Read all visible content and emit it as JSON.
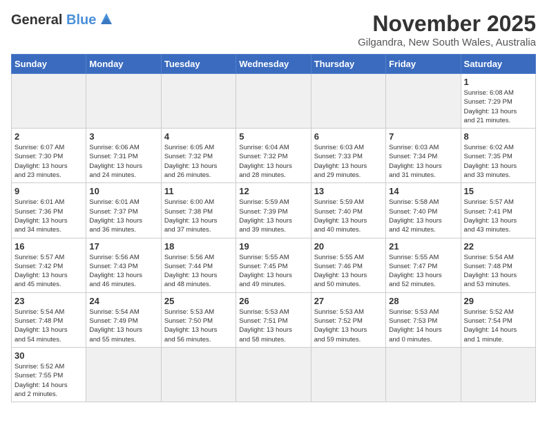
{
  "header": {
    "logo_general": "General",
    "logo_blue": "Blue",
    "month_title": "November 2025",
    "location": "Gilgandra, New South Wales, Australia"
  },
  "weekdays": [
    "Sunday",
    "Monday",
    "Tuesday",
    "Wednesday",
    "Thursday",
    "Friday",
    "Saturday"
  ],
  "weeks": [
    [
      {
        "day": "",
        "info": ""
      },
      {
        "day": "",
        "info": ""
      },
      {
        "day": "",
        "info": ""
      },
      {
        "day": "",
        "info": ""
      },
      {
        "day": "",
        "info": ""
      },
      {
        "day": "",
        "info": ""
      },
      {
        "day": "1",
        "info": "Sunrise: 6:08 AM\nSunset: 7:29 PM\nDaylight: 13 hours\nand 21 minutes."
      }
    ],
    [
      {
        "day": "2",
        "info": "Sunrise: 6:07 AM\nSunset: 7:30 PM\nDaylight: 13 hours\nand 23 minutes."
      },
      {
        "day": "3",
        "info": "Sunrise: 6:06 AM\nSunset: 7:31 PM\nDaylight: 13 hours\nand 24 minutes."
      },
      {
        "day": "4",
        "info": "Sunrise: 6:05 AM\nSunset: 7:32 PM\nDaylight: 13 hours\nand 26 minutes."
      },
      {
        "day": "5",
        "info": "Sunrise: 6:04 AM\nSunset: 7:32 PM\nDaylight: 13 hours\nand 28 minutes."
      },
      {
        "day": "6",
        "info": "Sunrise: 6:03 AM\nSunset: 7:33 PM\nDaylight: 13 hours\nand 29 minutes."
      },
      {
        "day": "7",
        "info": "Sunrise: 6:03 AM\nSunset: 7:34 PM\nDaylight: 13 hours\nand 31 minutes."
      },
      {
        "day": "8",
        "info": "Sunrise: 6:02 AM\nSunset: 7:35 PM\nDaylight: 13 hours\nand 33 minutes."
      }
    ],
    [
      {
        "day": "9",
        "info": "Sunrise: 6:01 AM\nSunset: 7:36 PM\nDaylight: 13 hours\nand 34 minutes."
      },
      {
        "day": "10",
        "info": "Sunrise: 6:01 AM\nSunset: 7:37 PM\nDaylight: 13 hours\nand 36 minutes."
      },
      {
        "day": "11",
        "info": "Sunrise: 6:00 AM\nSunset: 7:38 PM\nDaylight: 13 hours\nand 37 minutes."
      },
      {
        "day": "12",
        "info": "Sunrise: 5:59 AM\nSunset: 7:39 PM\nDaylight: 13 hours\nand 39 minutes."
      },
      {
        "day": "13",
        "info": "Sunrise: 5:59 AM\nSunset: 7:40 PM\nDaylight: 13 hours\nand 40 minutes."
      },
      {
        "day": "14",
        "info": "Sunrise: 5:58 AM\nSunset: 7:40 PM\nDaylight: 13 hours\nand 42 minutes."
      },
      {
        "day": "15",
        "info": "Sunrise: 5:57 AM\nSunset: 7:41 PM\nDaylight: 13 hours\nand 43 minutes."
      }
    ],
    [
      {
        "day": "16",
        "info": "Sunrise: 5:57 AM\nSunset: 7:42 PM\nDaylight: 13 hours\nand 45 minutes."
      },
      {
        "day": "17",
        "info": "Sunrise: 5:56 AM\nSunset: 7:43 PM\nDaylight: 13 hours\nand 46 minutes."
      },
      {
        "day": "18",
        "info": "Sunrise: 5:56 AM\nSunset: 7:44 PM\nDaylight: 13 hours\nand 48 minutes."
      },
      {
        "day": "19",
        "info": "Sunrise: 5:55 AM\nSunset: 7:45 PM\nDaylight: 13 hours\nand 49 minutes."
      },
      {
        "day": "20",
        "info": "Sunrise: 5:55 AM\nSunset: 7:46 PM\nDaylight: 13 hours\nand 50 minutes."
      },
      {
        "day": "21",
        "info": "Sunrise: 5:55 AM\nSunset: 7:47 PM\nDaylight: 13 hours\nand 52 minutes."
      },
      {
        "day": "22",
        "info": "Sunrise: 5:54 AM\nSunset: 7:48 PM\nDaylight: 13 hours\nand 53 minutes."
      }
    ],
    [
      {
        "day": "23",
        "info": "Sunrise: 5:54 AM\nSunset: 7:48 PM\nDaylight: 13 hours\nand 54 minutes."
      },
      {
        "day": "24",
        "info": "Sunrise: 5:54 AM\nSunset: 7:49 PM\nDaylight: 13 hours\nand 55 minutes."
      },
      {
        "day": "25",
        "info": "Sunrise: 5:53 AM\nSunset: 7:50 PM\nDaylight: 13 hours\nand 56 minutes."
      },
      {
        "day": "26",
        "info": "Sunrise: 5:53 AM\nSunset: 7:51 PM\nDaylight: 13 hours\nand 58 minutes."
      },
      {
        "day": "27",
        "info": "Sunrise: 5:53 AM\nSunset: 7:52 PM\nDaylight: 13 hours\nand 59 minutes."
      },
      {
        "day": "28",
        "info": "Sunrise: 5:53 AM\nSunset: 7:53 PM\nDaylight: 14 hours\nand 0 minutes."
      },
      {
        "day": "29",
        "info": "Sunrise: 5:52 AM\nSunset: 7:54 PM\nDaylight: 14 hours\nand 1 minute."
      }
    ],
    [
      {
        "day": "30",
        "info": "Sunrise: 5:52 AM\nSunset: 7:55 PM\nDaylight: 14 hours\nand 2 minutes."
      },
      {
        "day": "",
        "info": ""
      },
      {
        "day": "",
        "info": ""
      },
      {
        "day": "",
        "info": ""
      },
      {
        "day": "",
        "info": ""
      },
      {
        "day": "",
        "info": ""
      },
      {
        "day": "",
        "info": ""
      }
    ]
  ]
}
